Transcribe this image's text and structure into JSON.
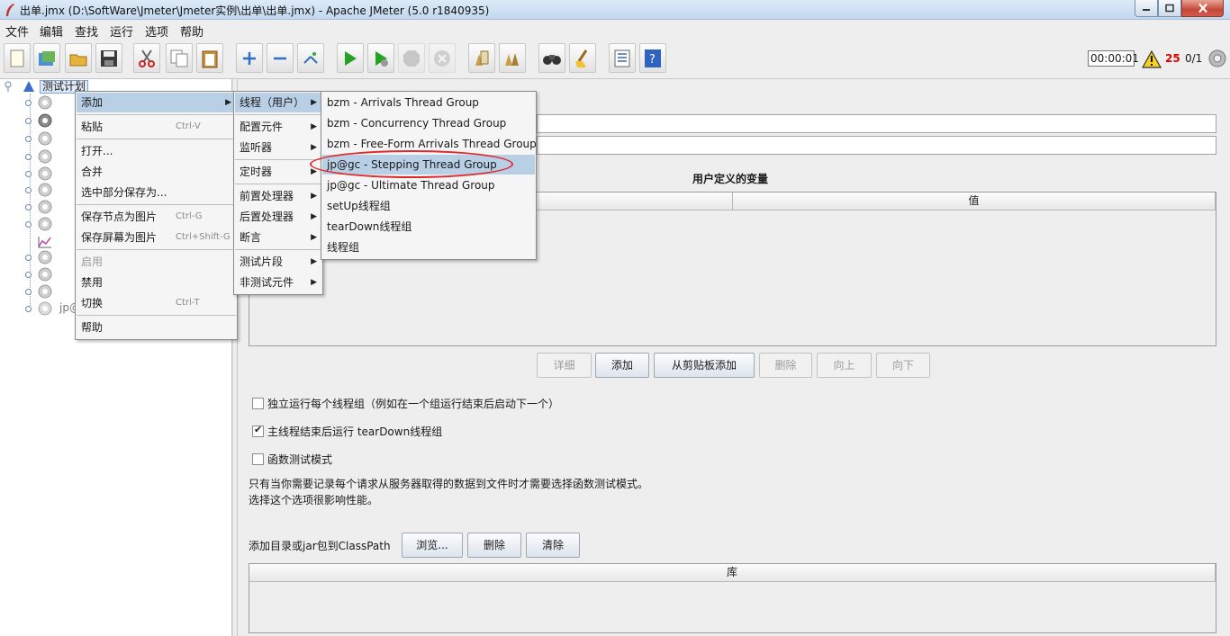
{
  "window": {
    "title": "出单.jmx (D:\\SoftWare\\Jmeter\\Jmeter实例\\出单\\出单.jmx) - Apache JMeter (5.0 r1840935)"
  },
  "menubar": [
    "文件",
    "编辑",
    "查找",
    "运行",
    "选项",
    "帮助"
  ],
  "toolbar": {
    "buttons": [
      "new-icon",
      "templates-icon",
      "open-icon",
      "save-icon",
      "cut-icon",
      "copy-icon",
      "paste-icon",
      "expand-icon",
      "collapse-icon",
      "toggle-icon",
      "start-icon",
      "start-no-pause-icon",
      "stop-icon",
      "shutdown-icon",
      "clear-icon",
      "clear-all-icon",
      "search-icon",
      "reset-search-icon",
      "function-helper-icon",
      "help-icon"
    ],
    "timer": "00:00:01",
    "error_count": "25",
    "threads": "0/1"
  },
  "tree": {
    "root_label": "测试计划",
    "partial_node": "jp@"
  },
  "context_menu": {
    "items": [
      {
        "label": "添加",
        "shortcut": "",
        "submenu": true,
        "selected": true
      },
      {
        "label": "粘贴",
        "shortcut": "Ctrl-V"
      },
      {
        "label": "打开...",
        "shortcut": ""
      },
      {
        "label": "合并",
        "shortcut": ""
      },
      {
        "label": "选中部分保存为...",
        "shortcut": ""
      },
      {
        "label": "保存节点为图片",
        "shortcut": "Ctrl-G"
      },
      {
        "label": "保存屏幕为图片",
        "shortcut": "Ctrl+Shift-G"
      },
      {
        "label": "启用",
        "shortcut": "",
        "disabled": true
      },
      {
        "label": "禁用",
        "shortcut": ""
      },
      {
        "label": "切换",
        "shortcut": "Ctrl-T"
      },
      {
        "label": "帮助",
        "shortcut": ""
      }
    ]
  },
  "add_submenu": {
    "items": [
      "线程（用户）",
      "配置元件",
      "监听器",
      "定时器",
      "前置处理器",
      "后置处理器",
      "断言",
      "测试片段",
      "非测试元件"
    ]
  },
  "thread_submenu": {
    "items": [
      "bzm - Arrivals Thread Group",
      "bzm - Concurrency Thread Group",
      "bzm - Free-Form Arrivals Thread Group",
      "jp@gc - Stepping Thread Group",
      "jp@gc - Ultimate Thread Group",
      "setUp线程组",
      "tearDown线程组",
      "线程组"
    ],
    "selected_index": 3
  },
  "panel": {
    "variables_title": "用户定义的变量",
    "col_value": "值",
    "buttons": {
      "detail": "详细",
      "add": "添加",
      "add_clipboard": "从剪贴板添加",
      "delete": "删除",
      "up": "向上",
      "down": "向下"
    },
    "checkbox_independent": "独立运行每个线程组（例如在一个组运行结束后启动下一个）",
    "checkbox_teardown": "主线程结束后运行 tearDown线程组",
    "checkbox_functional": "函数测试模式",
    "note_line1": "只有当你需要记录每个请求从服务器取得的数据到文件时才需要选择函数测试模式。",
    "note_line2": "选择这个选项很影响性能。",
    "classpath_label": "添加目录或jar包到ClassPath",
    "browse": "浏览...",
    "remove": "删除",
    "clear": "清除",
    "lib_header": "库"
  }
}
